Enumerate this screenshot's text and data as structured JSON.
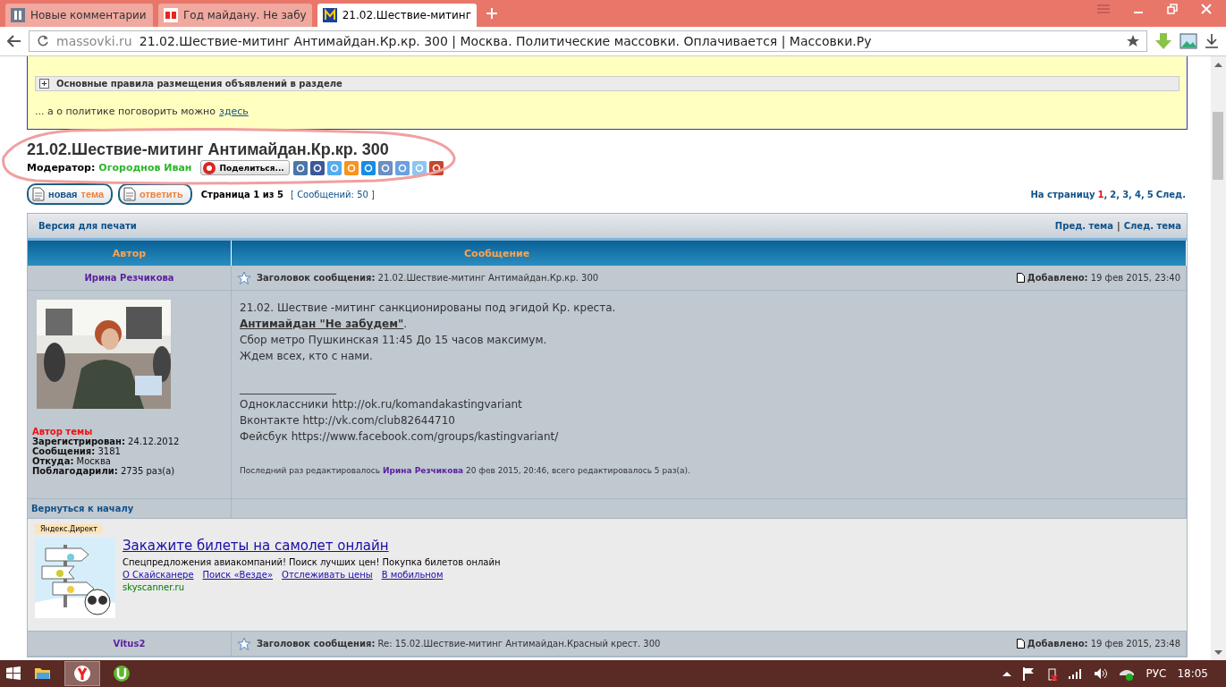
{
  "browser": {
    "tabs": [
      {
        "title": "Новые комментарии",
        "selected": false
      },
      {
        "title": "Год майдану. Не забу",
        "selected": false
      },
      {
        "title": "21.02.Шествие-митинг",
        "selected": true
      }
    ],
    "url_host": "massovki.ru",
    "url_rest": "21.02.Шествие-митинг Антимайдан.Кр.кр. 300 | Москва. Политические массовки. Оплачивается | Массовки.Ру"
  },
  "notice": {
    "toggle_symbol": "+",
    "rules_toggle": "Основные правила размещения объявлений в разделе",
    "politics_text": "... а о политике поговорить можно",
    "politics_link": "здесь"
  },
  "topic": {
    "title": "21.02.Шествие-митинг Антимайдан.Кр.кр. 300",
    "moderator_label": "Модератор:",
    "moderator": "Огороднов Иван",
    "share_button": "Поделиться..."
  },
  "actions": [
    {
      "parts": [
        {
          "text": "новая",
          "kind": "primary"
        },
        {
          "text": "тема",
          "kind": "accent"
        }
      ]
    },
    {
      "parts": [
        {
          "text": "ответить",
          "kind": "accent"
        }
      ]
    }
  ],
  "pagination": {
    "page_info": "Страница 1 из 5",
    "count": "[ Сообщений: 50 ]",
    "label": "На страницу",
    "pages": [
      {
        "label": "1",
        "selected": true
      },
      {
        "label": "2",
        "selected": false
      },
      {
        "label": "3",
        "selected": false
      },
      {
        "label": "4",
        "selected": false
      },
      {
        "label": "5",
        "selected": false
      }
    ],
    "separator": ",",
    "next": "След."
  },
  "topic_nav": {
    "print_link": "Версия для печати",
    "prev_topic": "Пред. тема",
    "separator": "|",
    "next_topic": "След. тема"
  },
  "columns": [
    "Автор",
    "Сообщение"
  ],
  "posts": [
    {
      "author": "Ирина Резчикова",
      "subject_label": "Заголовок сообщения:",
      "subject": "21.02.Шествие-митинг Антимайдан.Кр.кр. 300",
      "added_label": "Добавлено:",
      "added": "19 фев 2015, 23:40",
      "avatar": {
        "kind": "picture"
      },
      "author_badge": "Автор темы",
      "stats": [
        {
          "label": "Зарегистрирован:",
          "value": "24.12.2012"
        },
        {
          "label": "Сообщения:",
          "value": "3181"
        },
        {
          "label": "Откуда:",
          "value": "Москва"
        },
        {
          "label": "Поблагодарили:",
          "value": "2735 раз(а)"
        }
      ],
      "body": [
        {
          "kind": "text",
          "text": "21.02. Шествие -митинг санкционированы под эгидой Кр. креста."
        },
        {
          "kind": "link",
          "text": "Антимайдан \"Не забудем\"",
          "suffix": "."
        },
        {
          "kind": "text",
          "text": "Сбор метро Пушкинская 11:45 До 15 часов максимум."
        },
        {
          "kind": "text",
          "text": "Ждем всех, кто с нами."
        },
        {
          "kind": "gap"
        },
        {
          "kind": "text",
          "text": "__________________"
        },
        {
          "kind": "text",
          "text": "Одноклассники http://ok.ru/komandakastingvariant"
        },
        {
          "kind": "text",
          "text": "Вконтакте http://vk.com/club82644710"
        },
        {
          "kind": "text",
          "text": "Фейсбук https://www.facebook.com/groups/kastingvariant/"
        }
      ],
      "edit_note": {
        "prefix": "Последний раз редактировалось",
        "name": "Ирина Резчикова",
        "suffix": "20 фев 2015, 20:46, всего редактировалось 5 раз(а)."
      },
      "back_link": "Вернуться к началу"
    },
    {
      "author": "Vitus2",
      "subject_label": "Заголовок сообщения:",
      "subject": "Re: 15.02.Шествие-митинг Антимайдан.Красный крест. 300",
      "added_label": "Добавлено:",
      "added": "19 фев 2015, 23:48"
    }
  ],
  "ad": {
    "label": "Яндекс.Директ",
    "title": "Закажите билеты на самолет онлайн",
    "text": "Спецпредложения авиакомпаний! Поиск лучших цен! Покупка билетов онлайн",
    "links": [
      "О Скайсканере",
      "Поиск «Везде»",
      "Отслеживать цены",
      "В мобильном"
    ],
    "domain": "skyscanner.ru"
  },
  "taskbar": {
    "apps": [
      {
        "kind": "folder",
        "selected": false
      },
      {
        "kind": "browser",
        "selected": true
      },
      {
        "kind": "torrent",
        "selected": false
      }
    ],
    "language": "РУС",
    "time": "18:05"
  }
}
